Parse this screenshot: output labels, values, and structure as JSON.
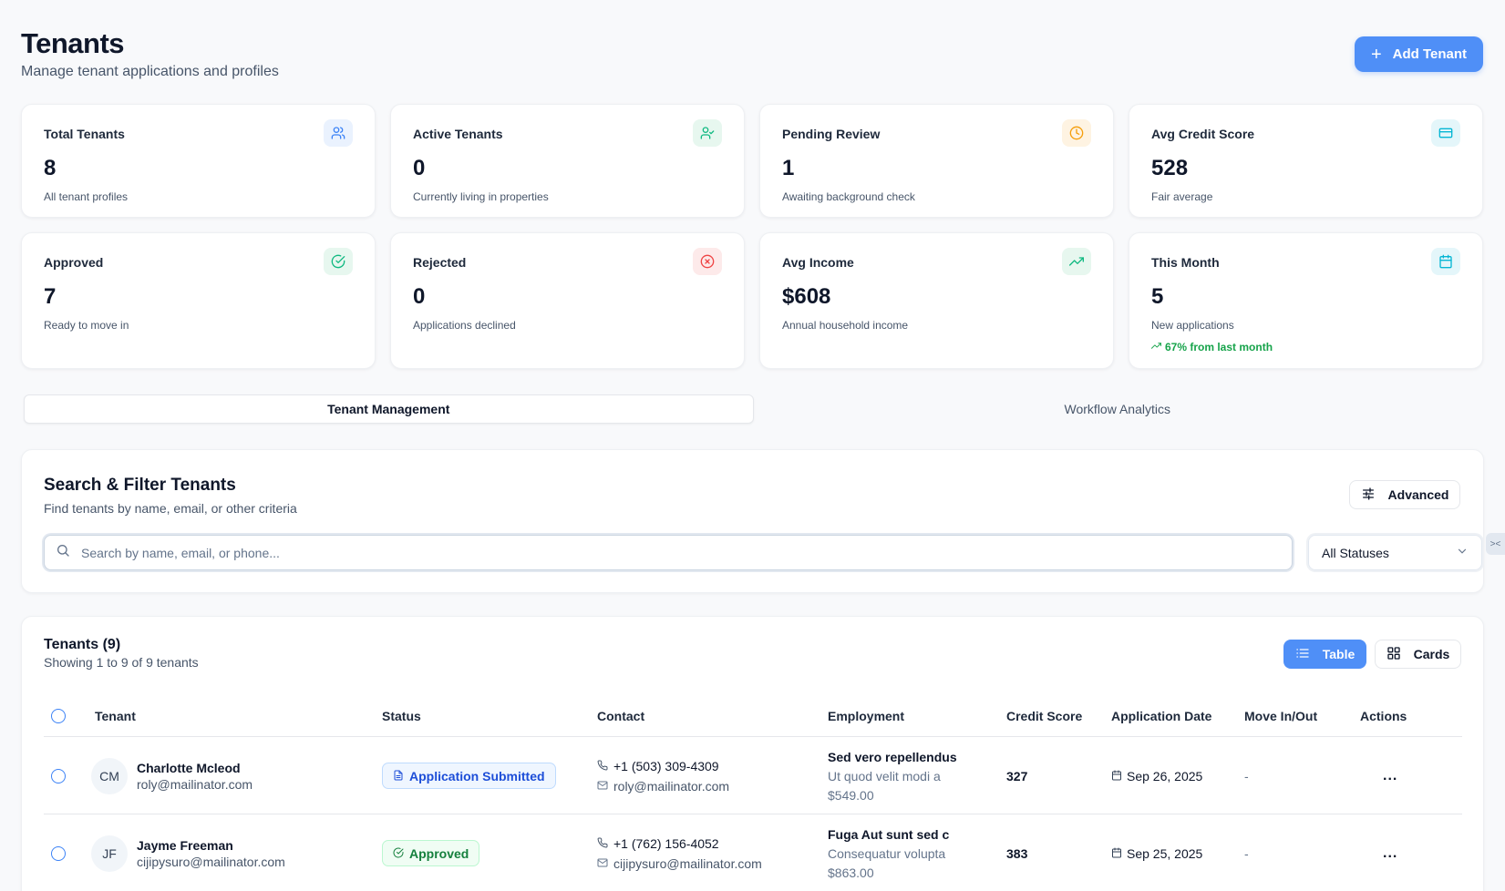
{
  "header": {
    "title": "Tenants",
    "subtitle": "Manage tenant applications and profiles",
    "add_button": "Add Tenant"
  },
  "stats": [
    {
      "label": "Total Tenants",
      "value": "8",
      "desc": "All tenant profiles",
      "icon": "users-icon",
      "color": "#3b82f6",
      "bg": "#eaf2fe"
    },
    {
      "label": "Active Tenants",
      "value": "0",
      "desc": "Currently living in properties",
      "icon": "user-check-icon",
      "color": "#10b981",
      "bg": "#e7f7ef"
    },
    {
      "label": "Pending Review",
      "value": "1",
      "desc": "Awaiting background check",
      "icon": "clock-icon",
      "color": "#f59e0b",
      "bg": "#fef3e2"
    },
    {
      "label": "Avg Credit Score",
      "value": "528",
      "desc": "Fair average",
      "icon": "credit-card-icon",
      "color": "#06b6d4",
      "bg": "#e4f6fa"
    },
    {
      "label": "Approved",
      "value": "7",
      "desc": "Ready to move in",
      "icon": "check-circle-icon",
      "color": "#10b981",
      "bg": "#e7f7ef"
    },
    {
      "label": "Rejected",
      "value": "0",
      "desc": "Applications declined",
      "icon": "x-circle-icon",
      "color": "#ef4444",
      "bg": "#fdeaea"
    },
    {
      "label": "Avg Income",
      "value": "$608",
      "desc": "Annual household income",
      "icon": "trending-up-icon",
      "color": "#10b981",
      "bg": "#e7f7ef"
    },
    {
      "label": "This Month",
      "value": "5",
      "desc": "New applications",
      "trend": "67% from last month",
      "icon": "calendar-icon",
      "color": "#06b6d4",
      "bg": "#e4f6fa"
    }
  ],
  "tabs": [
    "Tenant Management",
    "Workflow Analytics"
  ],
  "search": {
    "title": "Search & Filter Tenants",
    "subtitle": "Find tenants by name, email, or other criteria",
    "advanced_label": "Advanced",
    "placeholder": "Search by name, email, or phone...",
    "status_value": "All Statuses"
  },
  "table": {
    "title": "Tenants (9)",
    "subtitle": "Showing 1 to 9 of 9 tenants",
    "view_table": "Table",
    "view_cards": "Cards",
    "columns": [
      "Tenant",
      "Status",
      "Contact",
      "Employment",
      "Credit Score",
      "Application Date",
      "Move In/Out",
      "Actions"
    ],
    "rows": [
      {
        "initials": "CM",
        "name": "Charlotte Mcleod",
        "email": "roly@mailinator.com",
        "status": "Application Submitted",
        "status_color": "blue",
        "phone": "+1 (503) 309-4309",
        "contact_email": "roly@mailinator.com",
        "employer": "Sed vero repellendus",
        "company": "Ut quod velit modi a",
        "income": "$549.00",
        "credit": "327",
        "date": "Sep 26, 2025",
        "move": "-",
        "actions": "..."
      },
      {
        "initials": "JF",
        "name": "Jayme Freeman",
        "email": "cijipysuro@mailinator.com",
        "status": "Approved",
        "status_color": "green",
        "phone": "+1 (762) 156-4052",
        "contact_email": "cijipysuro@mailinator.com",
        "employer": "Fuga Aut sunt sed c",
        "company": "Consequatur volupta",
        "income": "$863.00",
        "credit": "383",
        "date": "Sep 25, 2025",
        "move": "-",
        "actions": "..."
      }
    ]
  }
}
